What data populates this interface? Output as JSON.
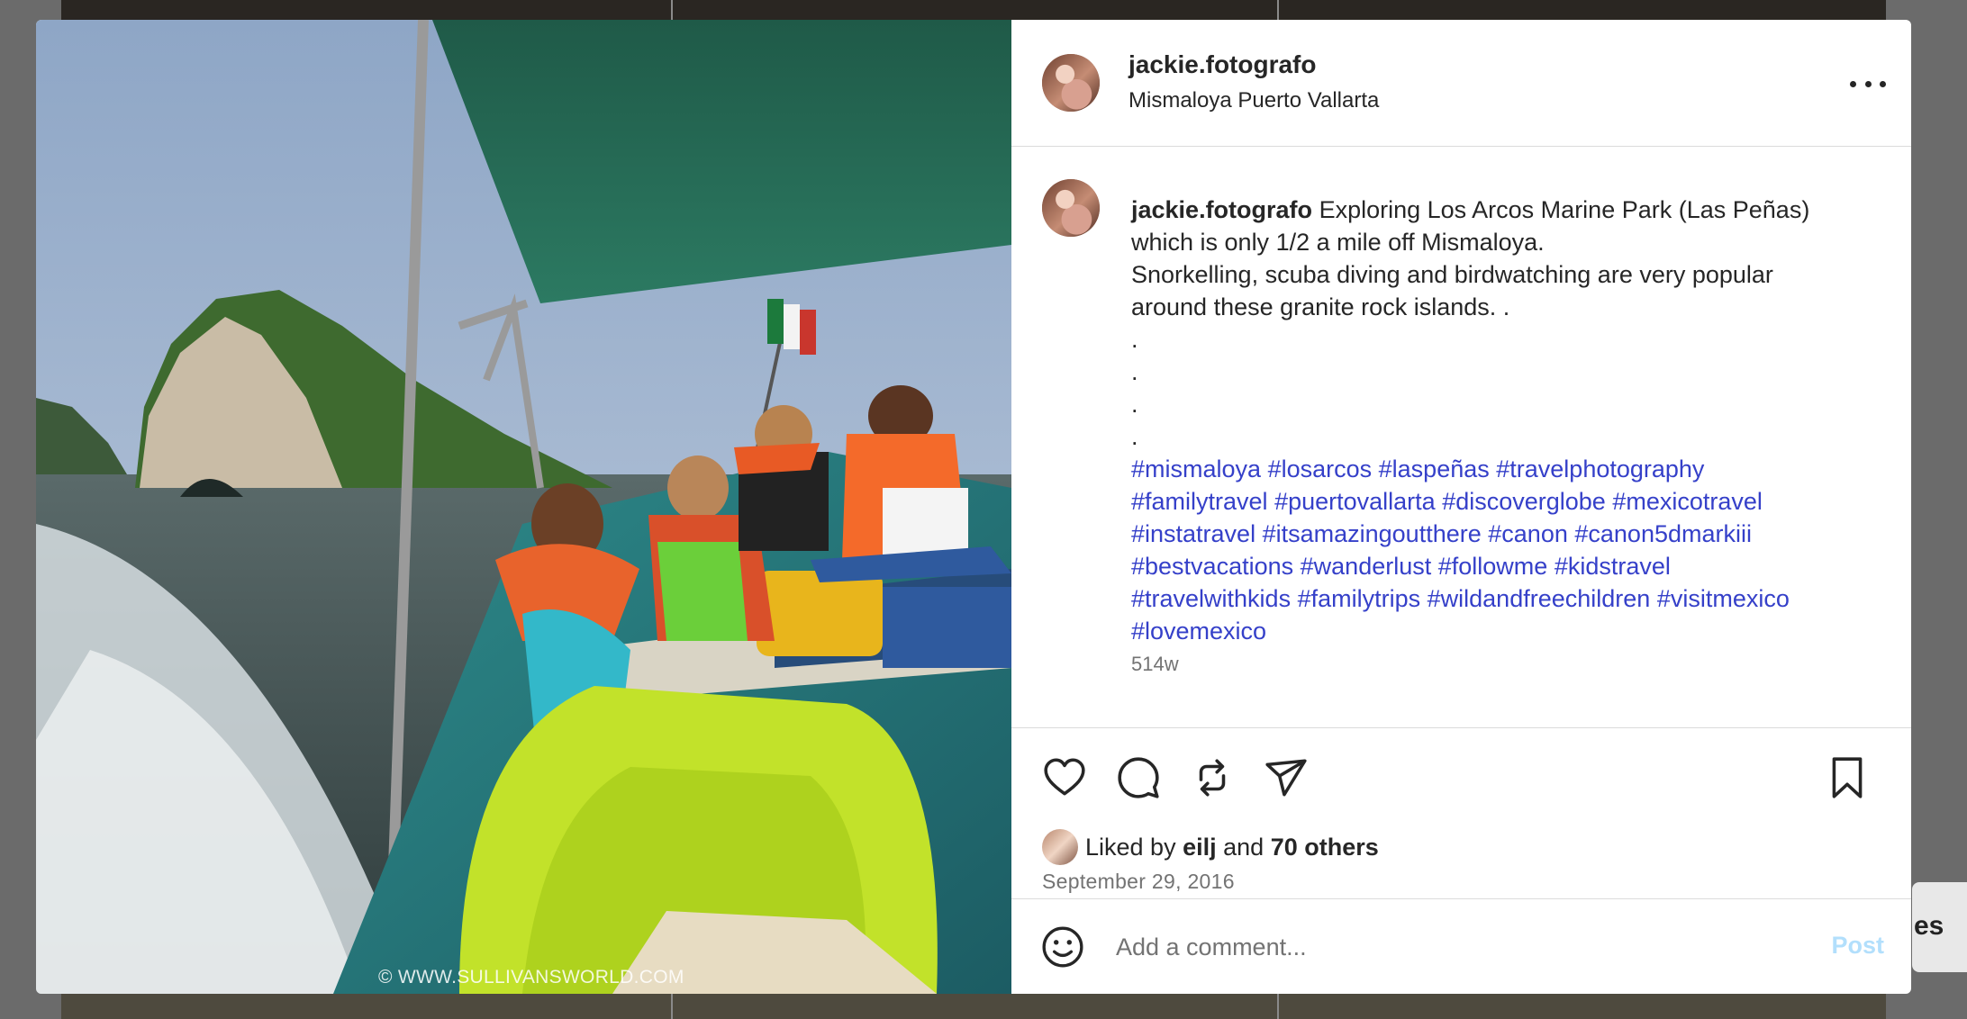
{
  "post": {
    "username": "jackie.fotografo",
    "location": "Mismaloya Puerto Vallarta",
    "watermark": "© WWW.SULLIVANSWORLD.COM",
    "caption": {
      "username": "jackie.fotografo",
      "lines": [
        "Exploring Los Arcos Marine Park (Las Peñas)",
        "which is only 1/2 a mile off Mismaloya.",
        "Snorkelling, scuba diving and birdwatching are very popular",
        "around these granite rock islands. .",
        ".",
        ".",
        ".",
        "."
      ],
      "hashtags": [
        "#mismaloya",
        "#losarcos",
        "#laspeñas",
        "#travelphotography",
        "#familytravel",
        "#puertovallarta",
        "#discoverglobe",
        "#mexicotravel",
        "#instatravel",
        "#itsamazingoutthere",
        "#canon",
        "#canon5dmarkiii",
        "#bestvacations",
        "#wanderlust",
        "#followme",
        "#kidstravel",
        "#travelwithkids",
        "#familytrips",
        "#wildandfreechildren",
        "#visitmexico",
        "#lovemexico"
      ],
      "time_ago": "514w"
    },
    "likes": {
      "prefix": "Liked by",
      "user": "eilj",
      "conj": "and",
      "others": "70 others"
    },
    "date": "September 29, 2016"
  },
  "comment_box": {
    "placeholder": "Add a comment...",
    "post_label": "Post"
  },
  "background_peek_text": "es",
  "colors": {
    "hashtag": "#3540c9",
    "post_button_disabled": "#b2dffc",
    "text": "#262626",
    "muted": "#737373"
  },
  "icons": [
    "heart-icon",
    "comment-icon",
    "share-icon",
    "send-icon",
    "bookmark-icon",
    "emoji-icon",
    "more-icon"
  ]
}
